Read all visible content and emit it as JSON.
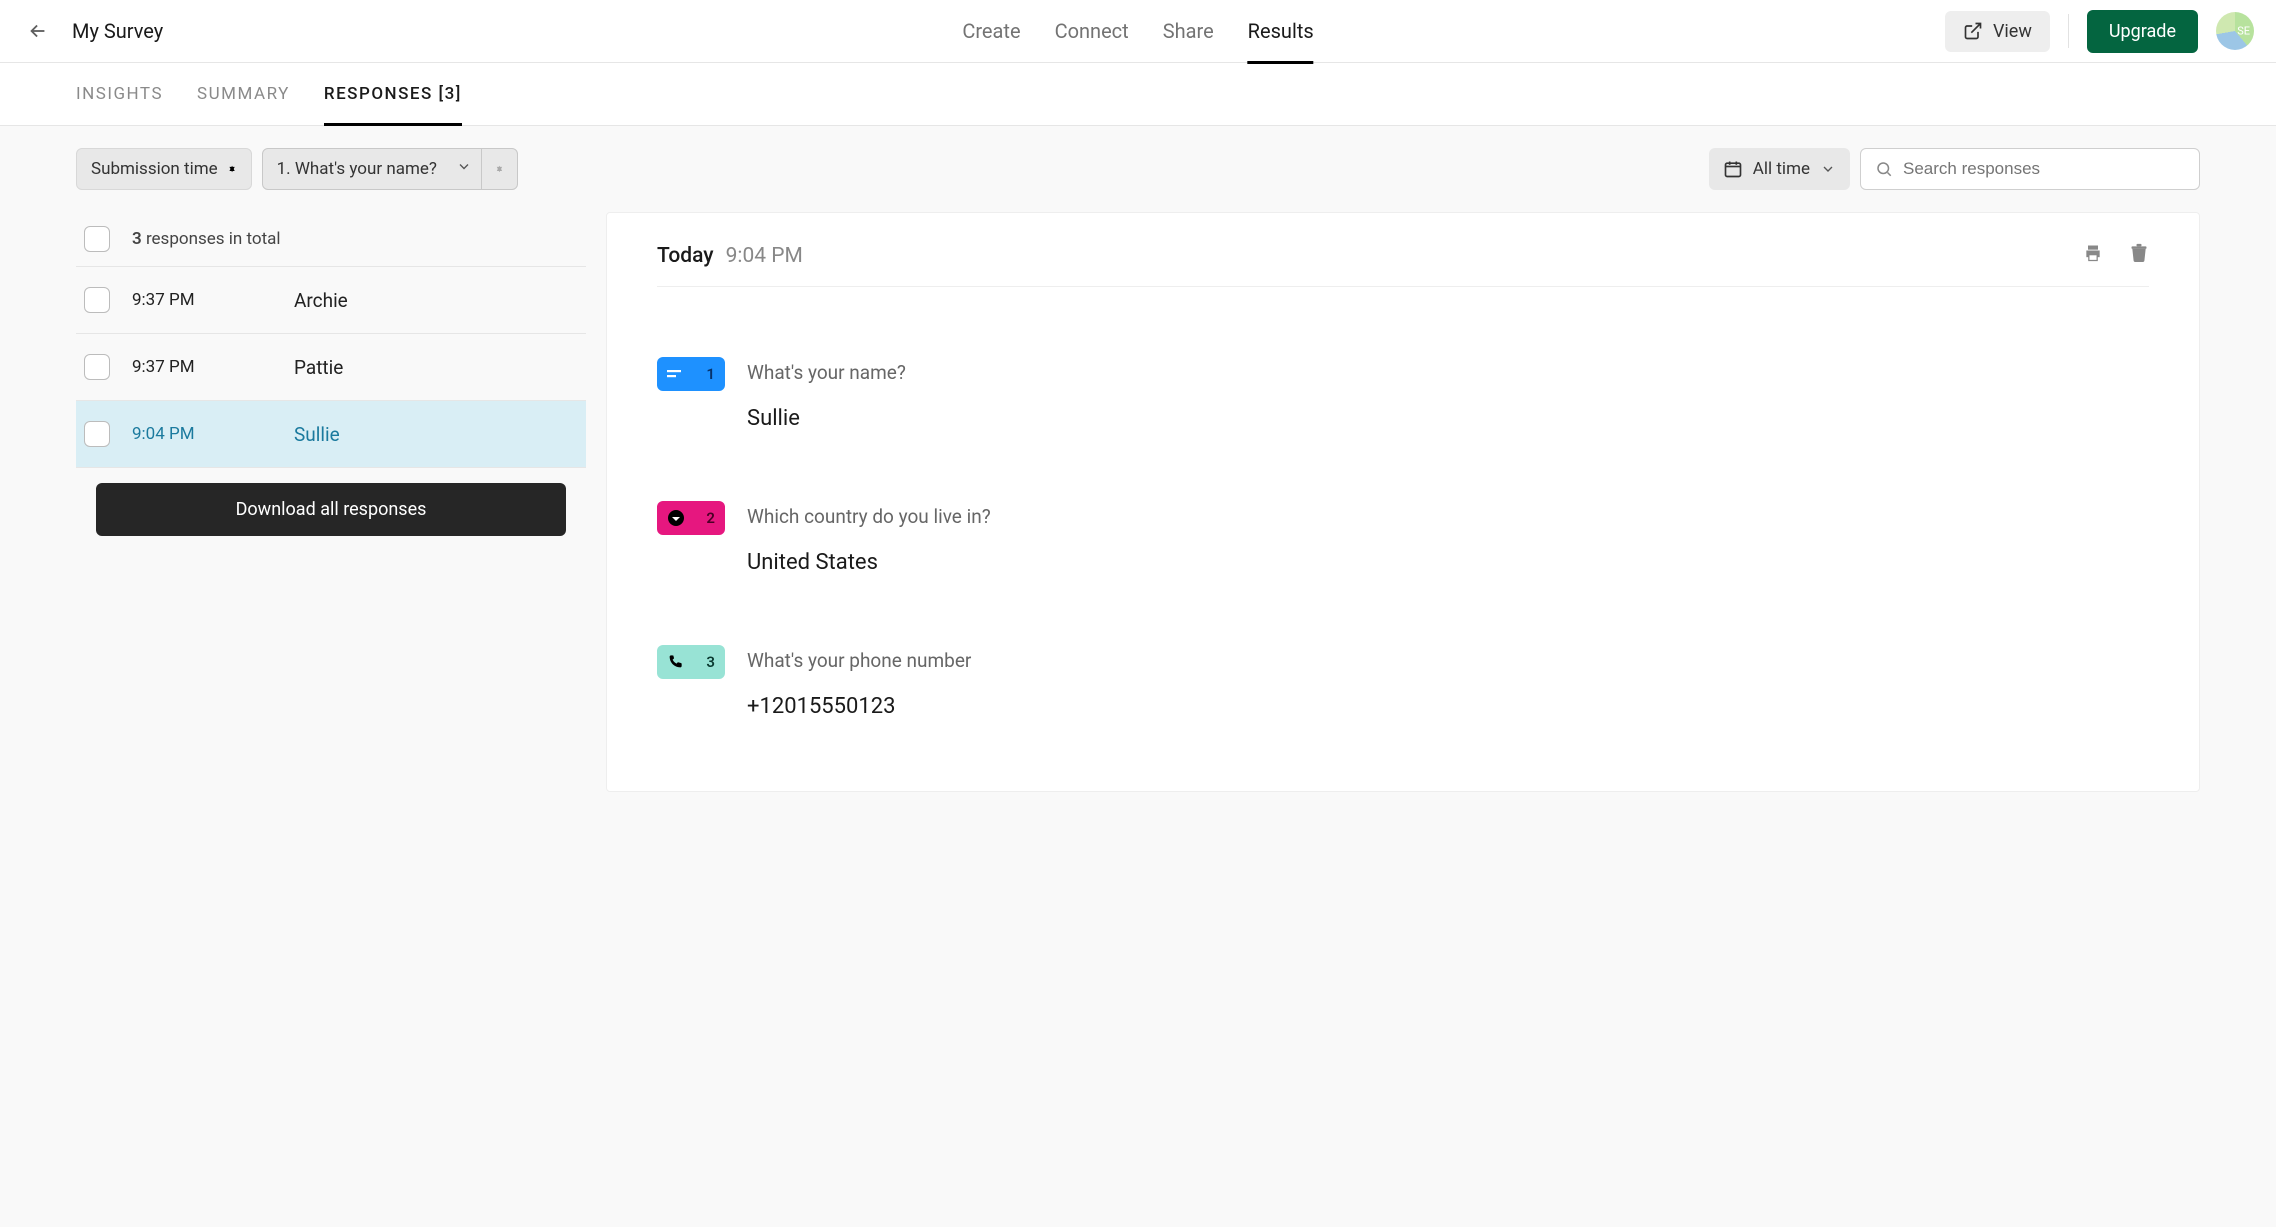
{
  "header": {
    "survey_title": "My Survey",
    "nav": {
      "create": "Create",
      "connect": "Connect",
      "share": "Share",
      "results": "Results"
    },
    "view_label": "View",
    "upgrade_label": "Upgrade",
    "avatar_initials": "SE"
  },
  "subtabs": {
    "insights": "INSIGHTS",
    "summary": "SUMMARY",
    "responses": "RESPONSES [3]"
  },
  "filters": {
    "sort_label": "Submission time",
    "question_label": "1. What's your name?",
    "date_label": "All time",
    "search_placeholder": "Search responses"
  },
  "list": {
    "total_count": "3",
    "total_suffix": "responses in total",
    "rows": [
      {
        "time": "9:37 PM",
        "name": "Archie"
      },
      {
        "time": "9:37 PM",
        "name": "Pattie"
      },
      {
        "time": "9:04 PM",
        "name": "Sullie"
      }
    ],
    "download_label": "Download all responses"
  },
  "detail": {
    "date_label": "Today",
    "time_label": "9:04 PM",
    "qa": [
      {
        "num": "1",
        "question": "What's your name?",
        "answer": "Sullie"
      },
      {
        "num": "2",
        "question": "Which country do you live in?",
        "answer": "United States"
      },
      {
        "num": "3",
        "question": "What's your phone number",
        "answer": "+12015550123"
      }
    ]
  }
}
